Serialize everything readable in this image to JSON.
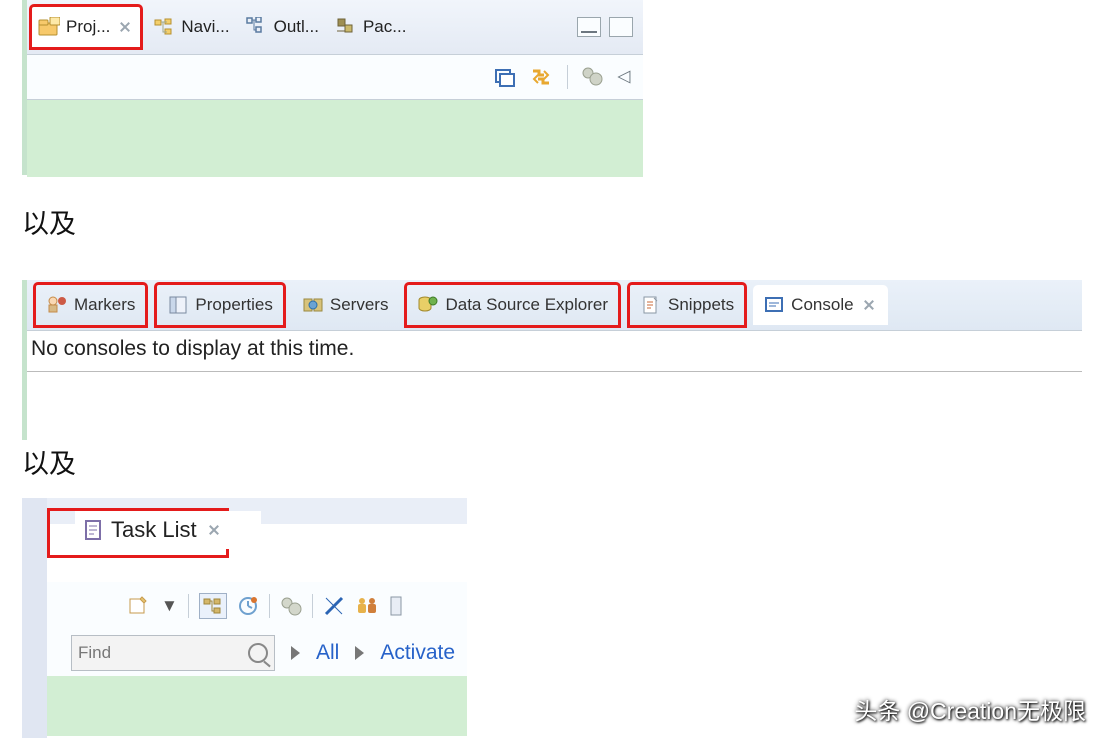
{
  "section1": {
    "tabs": [
      {
        "label": "Proj...",
        "active": true,
        "highlighted": true
      },
      {
        "label": "Navi..."
      },
      {
        "label": "Outl..."
      },
      {
        "label": "Pac..."
      }
    ]
  },
  "separator1": "以及",
  "section2": {
    "tabs": [
      {
        "label": "Markers",
        "highlighted": true
      },
      {
        "label": "Properties",
        "highlighted": true
      },
      {
        "label": "Servers"
      },
      {
        "label": "Data Source Explorer",
        "highlighted": true
      },
      {
        "label": "Snippets",
        "highlighted": true
      },
      {
        "label": "Console",
        "active": true
      }
    ],
    "message": "No consoles to display at this time."
  },
  "separator2": "以及",
  "section3": {
    "tab_label": "Task List",
    "find_placeholder": "Find",
    "filter_all": "All",
    "filter_activate": "Activate"
  },
  "watermark": "头条 @Creation无极限"
}
